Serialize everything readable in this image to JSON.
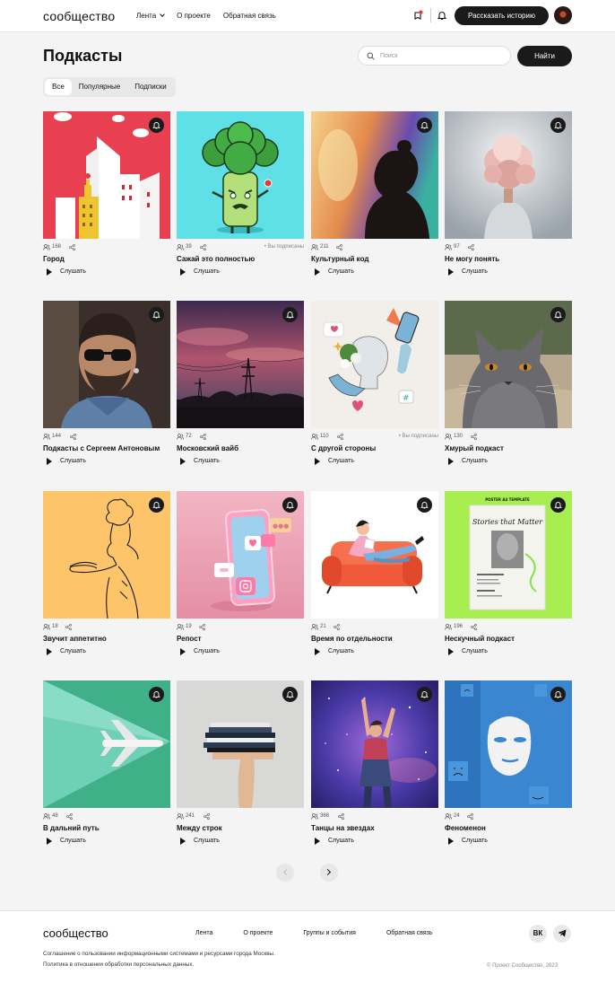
{
  "header": {
    "logo": "сообщество",
    "nav": [
      "Лента",
      "О проекте",
      "Обратная связь"
    ],
    "story_button": "Рассказать историю"
  },
  "page": {
    "title": "Подкасты",
    "search_placeholder": "Поиск",
    "search_button": "Найти",
    "tabs": [
      "Все",
      "Популярные",
      "Подписки"
    ],
    "active_tab": "Все"
  },
  "listen_label": "Слушать",
  "subscribed_label": "• Вы подписаны",
  "podcasts": [
    {
      "title": "Город",
      "listeners": "168",
      "subscribed": false
    },
    {
      "title": "Сажай это полностью",
      "listeners": "39",
      "subscribed": true
    },
    {
      "title": "Культурный код",
      "listeners": "211",
      "subscribed": false
    },
    {
      "title": "Не могу понять",
      "listeners": "97",
      "subscribed": false
    },
    {
      "title": "Подкасты с Сергеем Антоновым",
      "listeners": "144",
      "subscribed": false
    },
    {
      "title": "Московский вайб",
      "listeners": "72",
      "subscribed": false
    },
    {
      "title": "С другой стороны",
      "listeners": "110",
      "subscribed": true
    },
    {
      "title": "Хмурый подкаст",
      "listeners": "130",
      "subscribed": false
    },
    {
      "title": "Звучит аппетитно",
      "listeners": "18",
      "subscribed": false
    },
    {
      "title": "Репост",
      "listeners": "19",
      "subscribed": false
    },
    {
      "title": "Время по отдельности",
      "listeners": "21",
      "subscribed": false
    },
    {
      "title": "Нескучный подкаст",
      "listeners": "196",
      "subscribed": false
    },
    {
      "title": "В дальний путь",
      "listeners": "48",
      "subscribed": false
    },
    {
      "title": "Между строк",
      "listeners": "241",
      "subscribed": false
    },
    {
      "title": "Танцы на звездах",
      "listeners": "366",
      "subscribed": false
    },
    {
      "title": "Феноменон",
      "listeners": "24",
      "subscribed": false
    }
  ],
  "thumb_texts": {
    "poster_small": "POSTER A4 TEMPLATE",
    "poster_title": "Stories that Matter"
  },
  "footer": {
    "logo": "сообщество",
    "nav": [
      "Лента",
      "О проекте",
      "Группы и события",
      "Обратная связь"
    ],
    "social": [
      "ВК",
      "Telegram"
    ],
    "links": [
      "Соглашение о пользовании информационными системами и ресурсами города Москвы.",
      "Политика в отношении обработки персональных данных."
    ],
    "copyright": "© Проект Сообщество, 2023"
  },
  "colors": {
    "accent": "#1a1a1a",
    "background": "#f4f4f4"
  }
}
